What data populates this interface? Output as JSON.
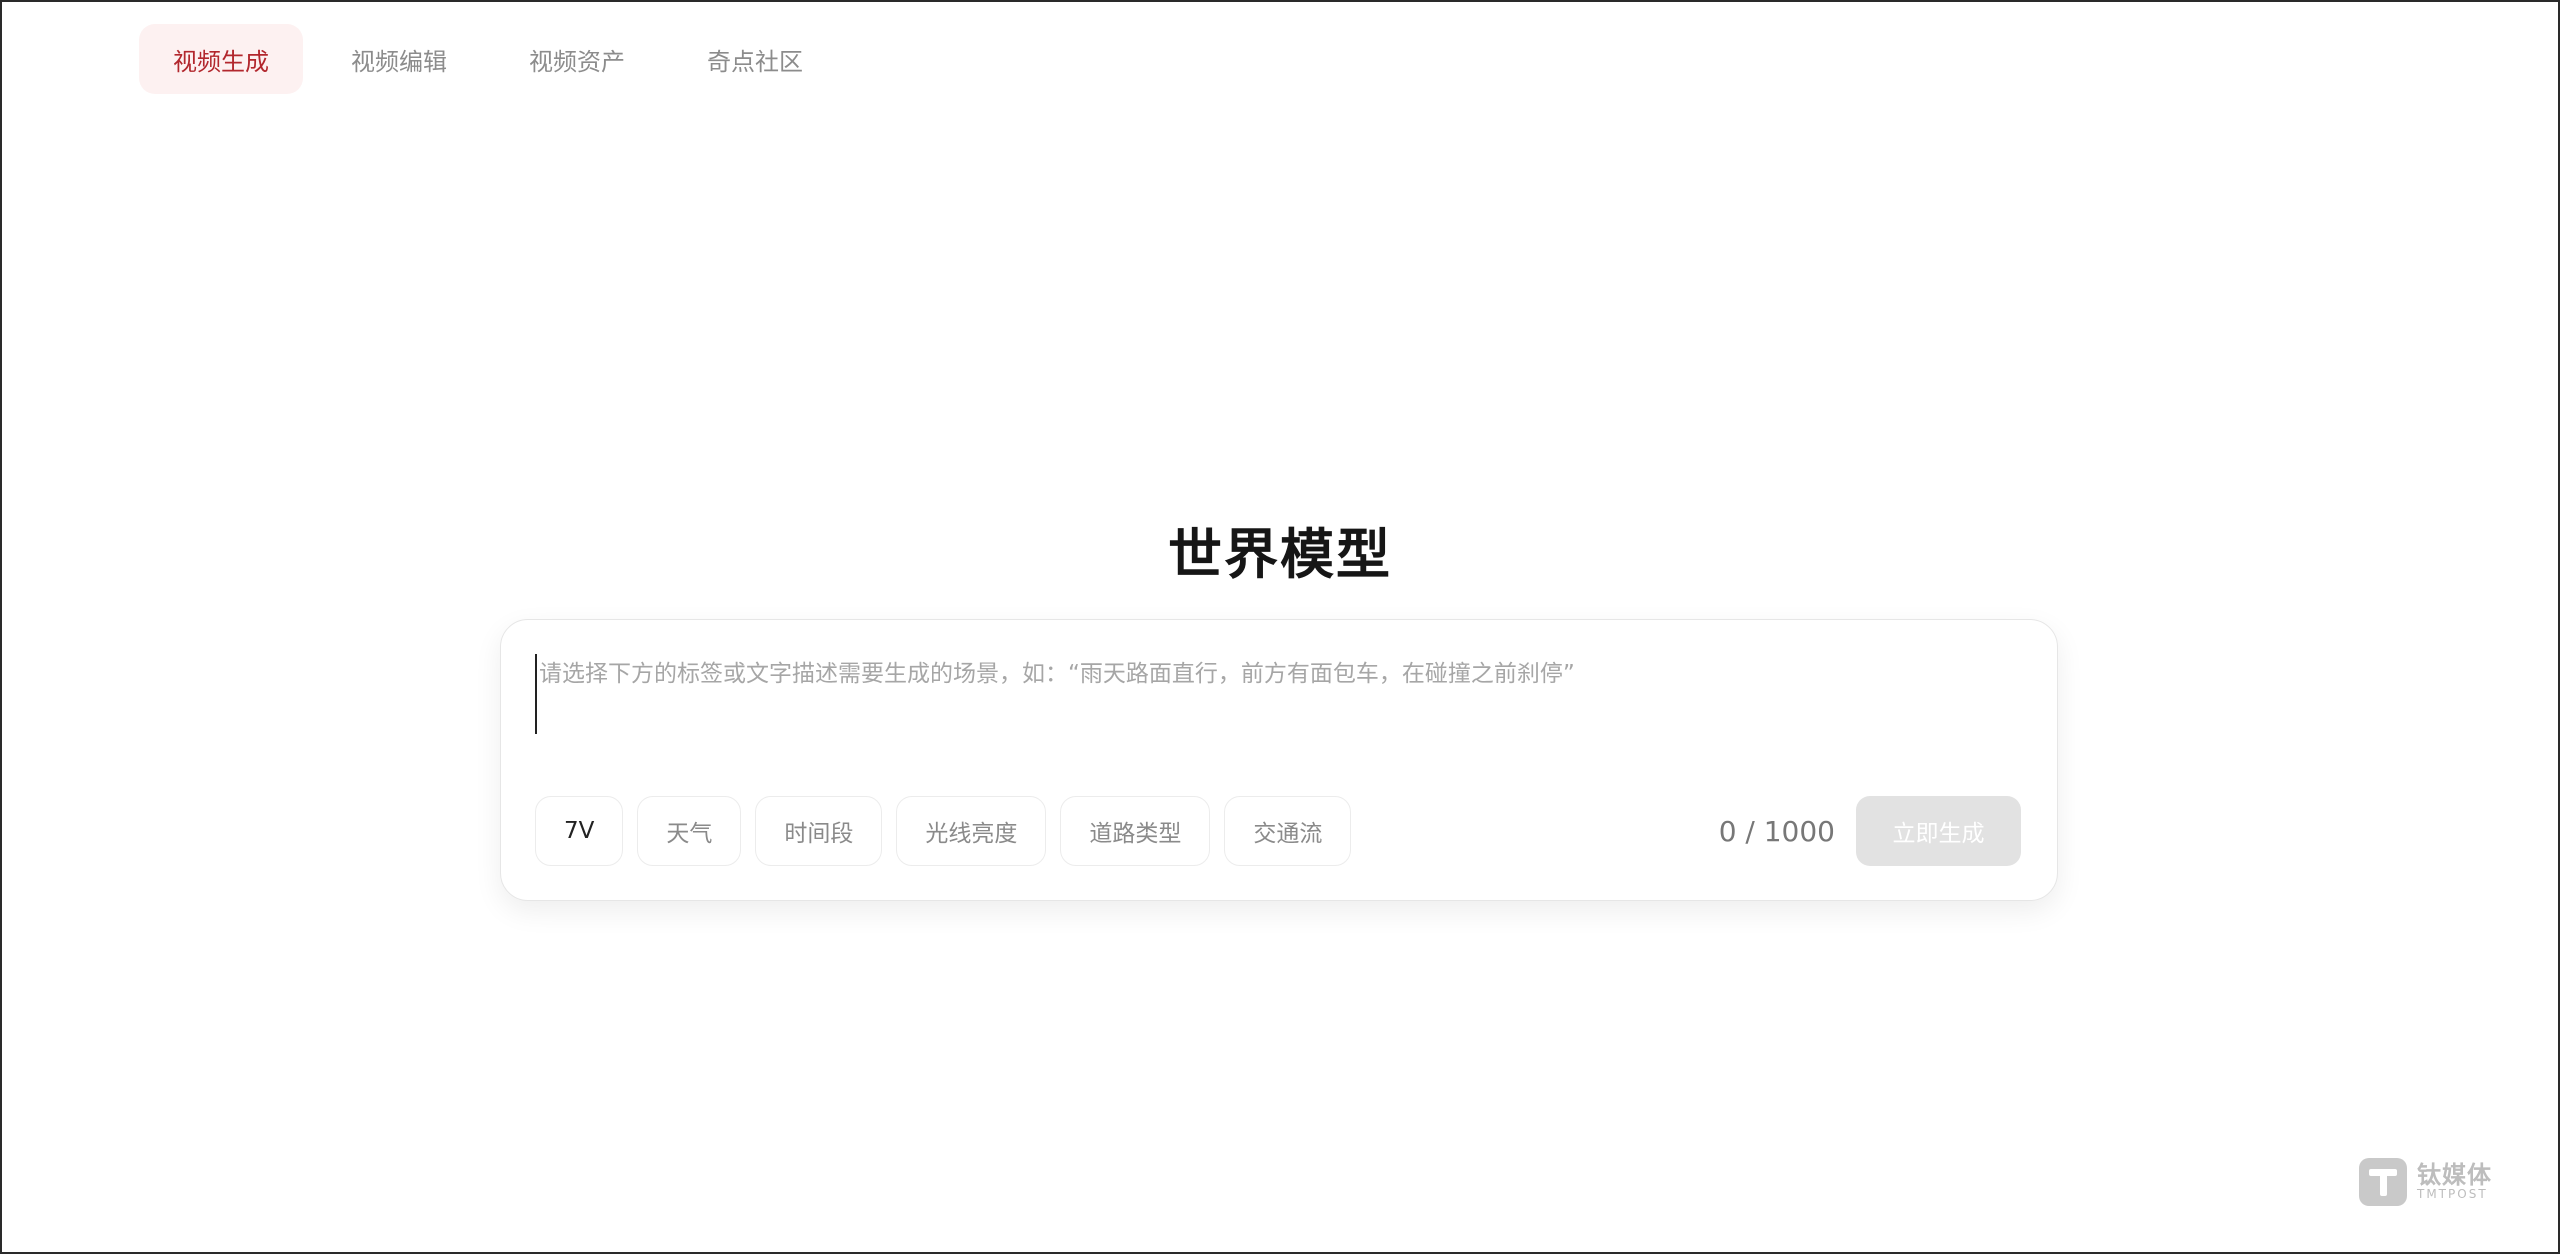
{
  "nav": {
    "tabs": [
      {
        "label": "视频生成",
        "active": true
      },
      {
        "label": "视频编辑",
        "active": false
      },
      {
        "label": "视频资产",
        "active": false
      },
      {
        "label": "奇点社区",
        "active": false
      }
    ]
  },
  "main": {
    "title": "世界模型",
    "prompt": {
      "value": "",
      "placeholder": "请选择下方的标签或文字描述需要生成的场景，如：“雨天路面直行，前方有面包车，在碰撞之前刹停”"
    },
    "tags": [
      "7V",
      "天气",
      "时间段",
      "光线亮度",
      "道路类型",
      "交通流"
    ],
    "counter": "0 / 1000",
    "generate_label": "立即生成"
  },
  "watermark": {
    "cn": "钛媒体",
    "en": "TMTPOST"
  },
  "colors": {
    "accent": "#b2272d",
    "active_tab_bg": "#fdf1f1",
    "button_disabled": "#e2e2e2"
  }
}
